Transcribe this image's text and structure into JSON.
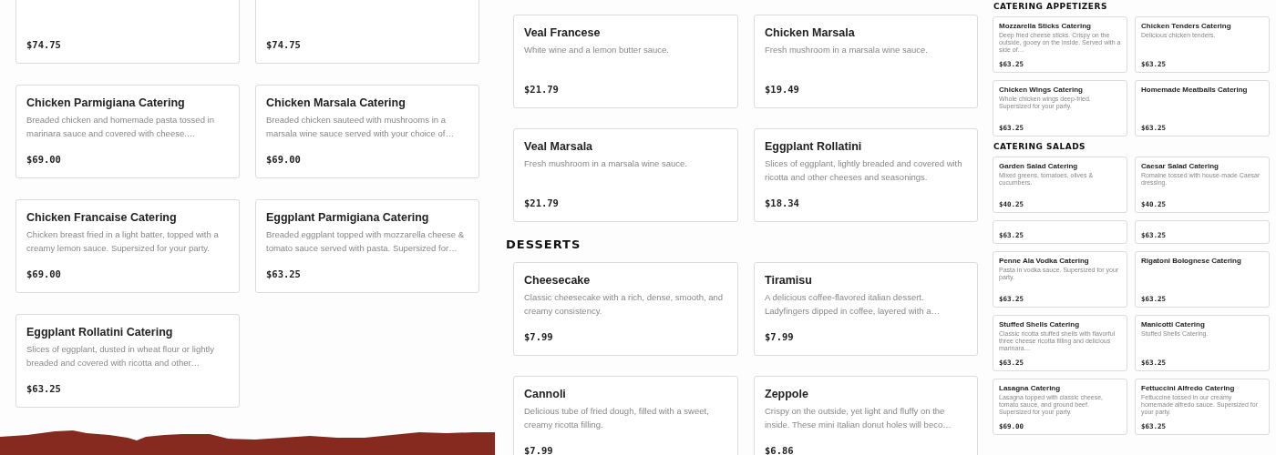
{
  "panels": [
    {
      "sections": [
        {
          "items": [
            {
              "price": "$74.75"
            },
            {
              "price": "$74.75"
            },
            {
              "title": "Chicken Parmigiana Catering",
              "description": "Breaded chicken and homemade pasta tossed in marinara sauce and covered with cheese.…",
              "price": "$69.00"
            },
            {
              "title": "Chicken Marsala Catering",
              "description": "Breaded chicken sauteed with mushrooms in a marsala wine sauce served with your choice of…",
              "price": "$69.00"
            },
            {
              "title": "Chicken Francaise Catering",
              "description": "Chicken breast fried in a light batter, topped with a creamy lemon sauce. Supersized for your party.",
              "price": "$69.00"
            },
            {
              "title": "Eggplant Parmigiana Catering",
              "description": "Breaded eggplant topped with mozzarella cheese & tomato sauce served with pasta. Supersized for…",
              "price": "$63.25"
            },
            {
              "title": "Eggplant Rollatini Catering",
              "description": "Slices of eggplant, dusted in wheat flour or lightly breaded and covered with ricotta and other…",
              "price": "$63.25"
            }
          ]
        }
      ]
    },
    {
      "sections": [
        {
          "items": [
            {
              "title": "Veal Francese",
              "description": "White wine and a lemon butter sauce.",
              "price": "$21.79"
            },
            {
              "title": "Chicken Marsala",
              "description": "Fresh mushroom in a marsala wine sauce.",
              "price": "$19.49"
            },
            {
              "title": "Veal Marsala",
              "description": "Fresh mushroom in a marsala wine sauce.",
              "price": "$21.79"
            },
            {
              "title": "Eggplant Rollatini",
              "description": "Slices of eggplant, lightly breaded and covered with ricotta and other cheeses and seasonings.",
              "price": "$18.34"
            }
          ]
        },
        {
          "heading": "DESSERTS",
          "items": [
            {
              "title": "Cheesecake",
              "description": "Classic cheesecake with a rich, dense, smooth, and creamy consistency.",
              "price": "$7.99"
            },
            {
              "title": "Tiramisu",
              "description": "A delicious coffee-flavored italian dessert. Ladyfingers dipped in coffee, layered with a…",
              "price": "$7.99"
            },
            {
              "title": "Cannoli",
              "description": "Delicious tube of fried dough, filled with a sweet, creamy ricotta filling.",
              "price": "$7.99"
            },
            {
              "title": "Zeppole",
              "description": "Crispy on the outside, yet light and fluffy on the inside. These mini Italian donut holes will beco…",
              "price": "$6.86"
            }
          ]
        }
      ]
    },
    {
      "sections": [
        {
          "heading": "CATERING APPETIZERS",
          "items": [
            {
              "title": "Mozzarella Sticks Catering",
              "description": "Deep fried cheese sticks. Crispy on the outside, gooey on the inside. Served with a side of…",
              "price": "$63.25"
            },
            {
              "title": "Chicken Tenders Catering",
              "description": "Delicious chicken tenders.",
              "price": "$63.25"
            },
            {
              "title": "Chicken Wings Catering",
              "description": "Whole chicken wings deep-fried. Supersized for your party.",
              "price": "$63.25"
            },
            {
              "title": "Homemade Meatballs Catering",
              "price": "$63.25"
            }
          ]
        },
        {
          "heading": "CATERING SALADS",
          "items": [
            {
              "title": "Garden Salad Catering",
              "description": "Mixed greens, tomatoes, olives & cucumbers.",
              "price": "$40.25"
            },
            {
              "title": "Caesar Salad Catering",
              "description": "Romaine tossed with house-made Caesar dressing.",
              "price": "$40.25"
            },
            {
              "price": "$63.25"
            },
            {
              "price": "$63.25"
            },
            {
              "title": "Penne Ala Vodka Catering",
              "description": "Pasta in vodka sauce. Supersized for your party.",
              "price": "$63.25"
            },
            {
              "title": "Rigatoni Bolognese Catering",
              "price": "$63.25"
            },
            {
              "title": "Stuffed Shells Catering",
              "description": "Classic ricotta stuffed shells with flavorful three cheese ricotta filling and delicious marinara…",
              "price": "$63.25"
            },
            {
              "title": "Manicotti Catering",
              "description": "Stuffed Shells Catering.",
              "price": "$63.25"
            },
            {
              "title": "Lasagna Catering",
              "description": "Lasagna topped with classic cheese, tomato sauce, and ground beef. Supersized for your party.",
              "price": "$69.00"
            },
            {
              "title": "Fettuccini Alfredo Catering",
              "description": "Fettuccine tossed in our creamy homemade alfredo sauce. Supersized for your party.",
              "price": "$63.25"
            }
          ]
        }
      ]
    }
  ]
}
